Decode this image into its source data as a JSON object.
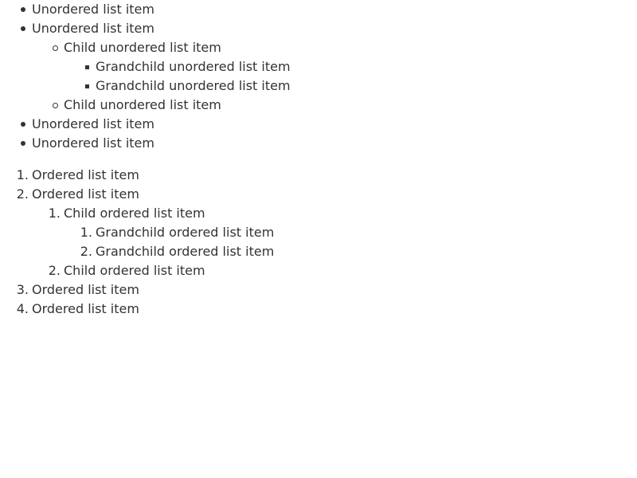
{
  "unordered": {
    "item1": "Unordered list item",
    "item2": "Unordered list item",
    "child1": "Child unordered list item",
    "grandchild1": "Grandchild unordered list item",
    "grandchild2": "Grandchild unordered list item",
    "child2": "Child unordered list item",
    "item3": "Unordered list item",
    "item4": "Unordered list item"
  },
  "ordered": {
    "item1": {
      "marker": "1.",
      "label": "Ordered list item"
    },
    "item2": {
      "marker": "2.",
      "label": "Ordered list item"
    },
    "child1": {
      "marker": "1.",
      "label": "Child ordered list item"
    },
    "grandchild1": {
      "marker": "1.",
      "label": "Grandchild ordered list item"
    },
    "grandchild2": {
      "marker": "2.",
      "label": "Grandchild ordered list item"
    },
    "child2": {
      "marker": "2.",
      "label": "Child ordered list item"
    },
    "item3": {
      "marker": "3.",
      "label": "Ordered list item"
    },
    "item4": {
      "marker": "4.",
      "label": "Ordered list item"
    }
  },
  "colors": {
    "text": "#333333",
    "background": "#ffffff"
  },
  "icons": {
    "level1_bullet": "disc-bullet-icon",
    "level2_bullet": "circle-bullet-icon",
    "level3_bullet": "square-bullet-icon"
  }
}
